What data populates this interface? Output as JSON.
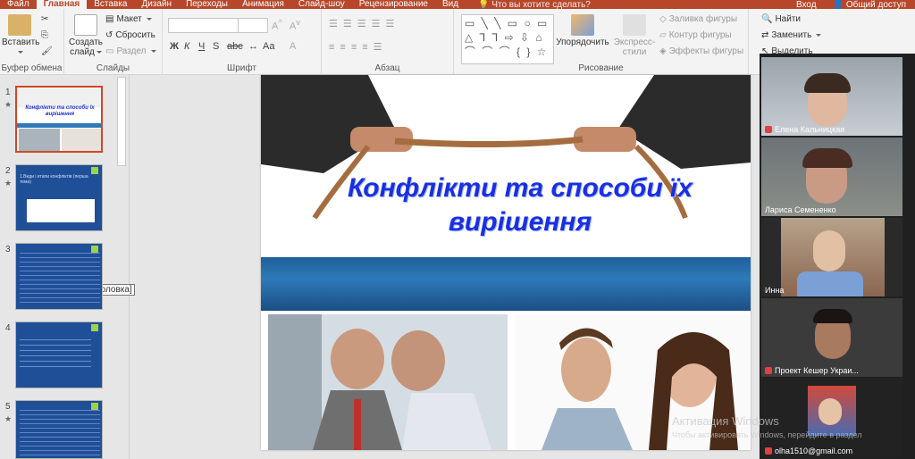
{
  "menu": {
    "tabs": [
      "Файл",
      "Главная",
      "Вставка",
      "Дизайн",
      "Переходы",
      "Анимация",
      "Слайд-шоу",
      "Рецензирование",
      "Вид"
    ],
    "active_tab": "Главная",
    "tell_me": "Что вы хотите сделать?",
    "login": "Вход",
    "share": "Общий доступ"
  },
  "ribbon": {
    "clipboard": {
      "paste": "Вставить",
      "label": "Буфер обмена"
    },
    "slides": {
      "new_slide_1": "Создать",
      "new_slide_2": "слайд",
      "layout": "Макет",
      "reset": "Сбросить",
      "section": "Раздел",
      "label": "Слайды"
    },
    "font": {
      "bold": "Ж",
      "italic": "К",
      "underline": "Ч",
      "strike": "S",
      "abc": "abc",
      "aa": "Aa",
      "grow": "A",
      "label": "Шрифт"
    },
    "paragraph": {
      "label": "Абзац"
    },
    "drawing": {
      "arrange_1": "Упорядочить",
      "styles_1": "Экспресс-",
      "styles_2": "стили",
      "fill": "Заливка фигуры",
      "outline": "Контур фигуры",
      "effects": "Эффекты фигуры",
      "label": "Рисование",
      "shapes_row1": "▭ ╲ ╲ ▭ ○ ▭",
      "shapes_row2": "△ ⅂ ⅂ ⇨ ⇩ ⌂",
      "shapes_row3": "⌒ ⌒ ⌒ { } ☆"
    },
    "editing": {
      "find": "Найти",
      "replace": "Заменить",
      "select": "Выделить"
    }
  },
  "thumbnails": [
    {
      "number": "1",
      "title": "Конфлікти та способи їх вирішення",
      "selected": true
    },
    {
      "number": "2",
      "title": "1.Види і етапи конфліктів (перша тема)",
      "selected": false
    },
    {
      "number": "3",
      "title": "",
      "selected": false
    },
    {
      "number": "4",
      "title": "",
      "selected": false
    },
    {
      "number": "5",
      "title": "",
      "selected": false
    }
  ],
  "tooltip": "[Без заголовка]",
  "slide": {
    "title": "Конфлікти та способи їх вирішення"
  },
  "participants": [
    {
      "name": "Елена Кальницкая"
    },
    {
      "name": "Лариса Семененко"
    },
    {
      "name": "Инна"
    },
    {
      "name": "Проект Кешер Украи..."
    },
    {
      "name": "olha1510@gmail.com"
    }
  ],
  "watermark": {
    "line1": "Активация Windows",
    "line2": "Чтобы активировать Windows, перейдите в раздел"
  },
  "colors": {
    "accent": "#b7472a",
    "title_blue": "#1a2fe0",
    "band": "#2e7ab8"
  }
}
